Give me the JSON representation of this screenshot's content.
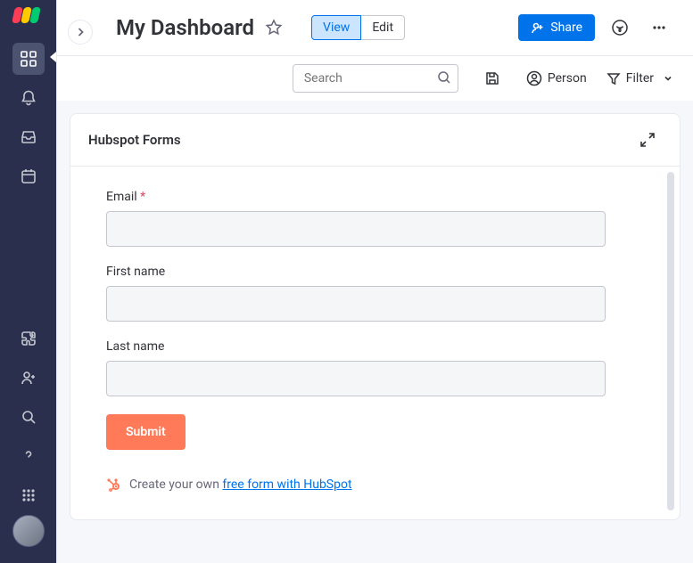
{
  "header": {
    "title": "My Dashboard",
    "tabs": {
      "view": "View",
      "edit": "Edit"
    },
    "share": "Share"
  },
  "toolbar": {
    "search_placeholder": "Search",
    "person": "Person",
    "filter": "Filter"
  },
  "card": {
    "title": "Hubspot Forms",
    "form": {
      "email_label": "Email",
      "required_mark": "*",
      "first_name_label": "First name",
      "last_name_label": "Last name",
      "submit": "Submit",
      "footer_prefix": "Create your own ",
      "footer_link": "free form with HubSpot"
    }
  }
}
